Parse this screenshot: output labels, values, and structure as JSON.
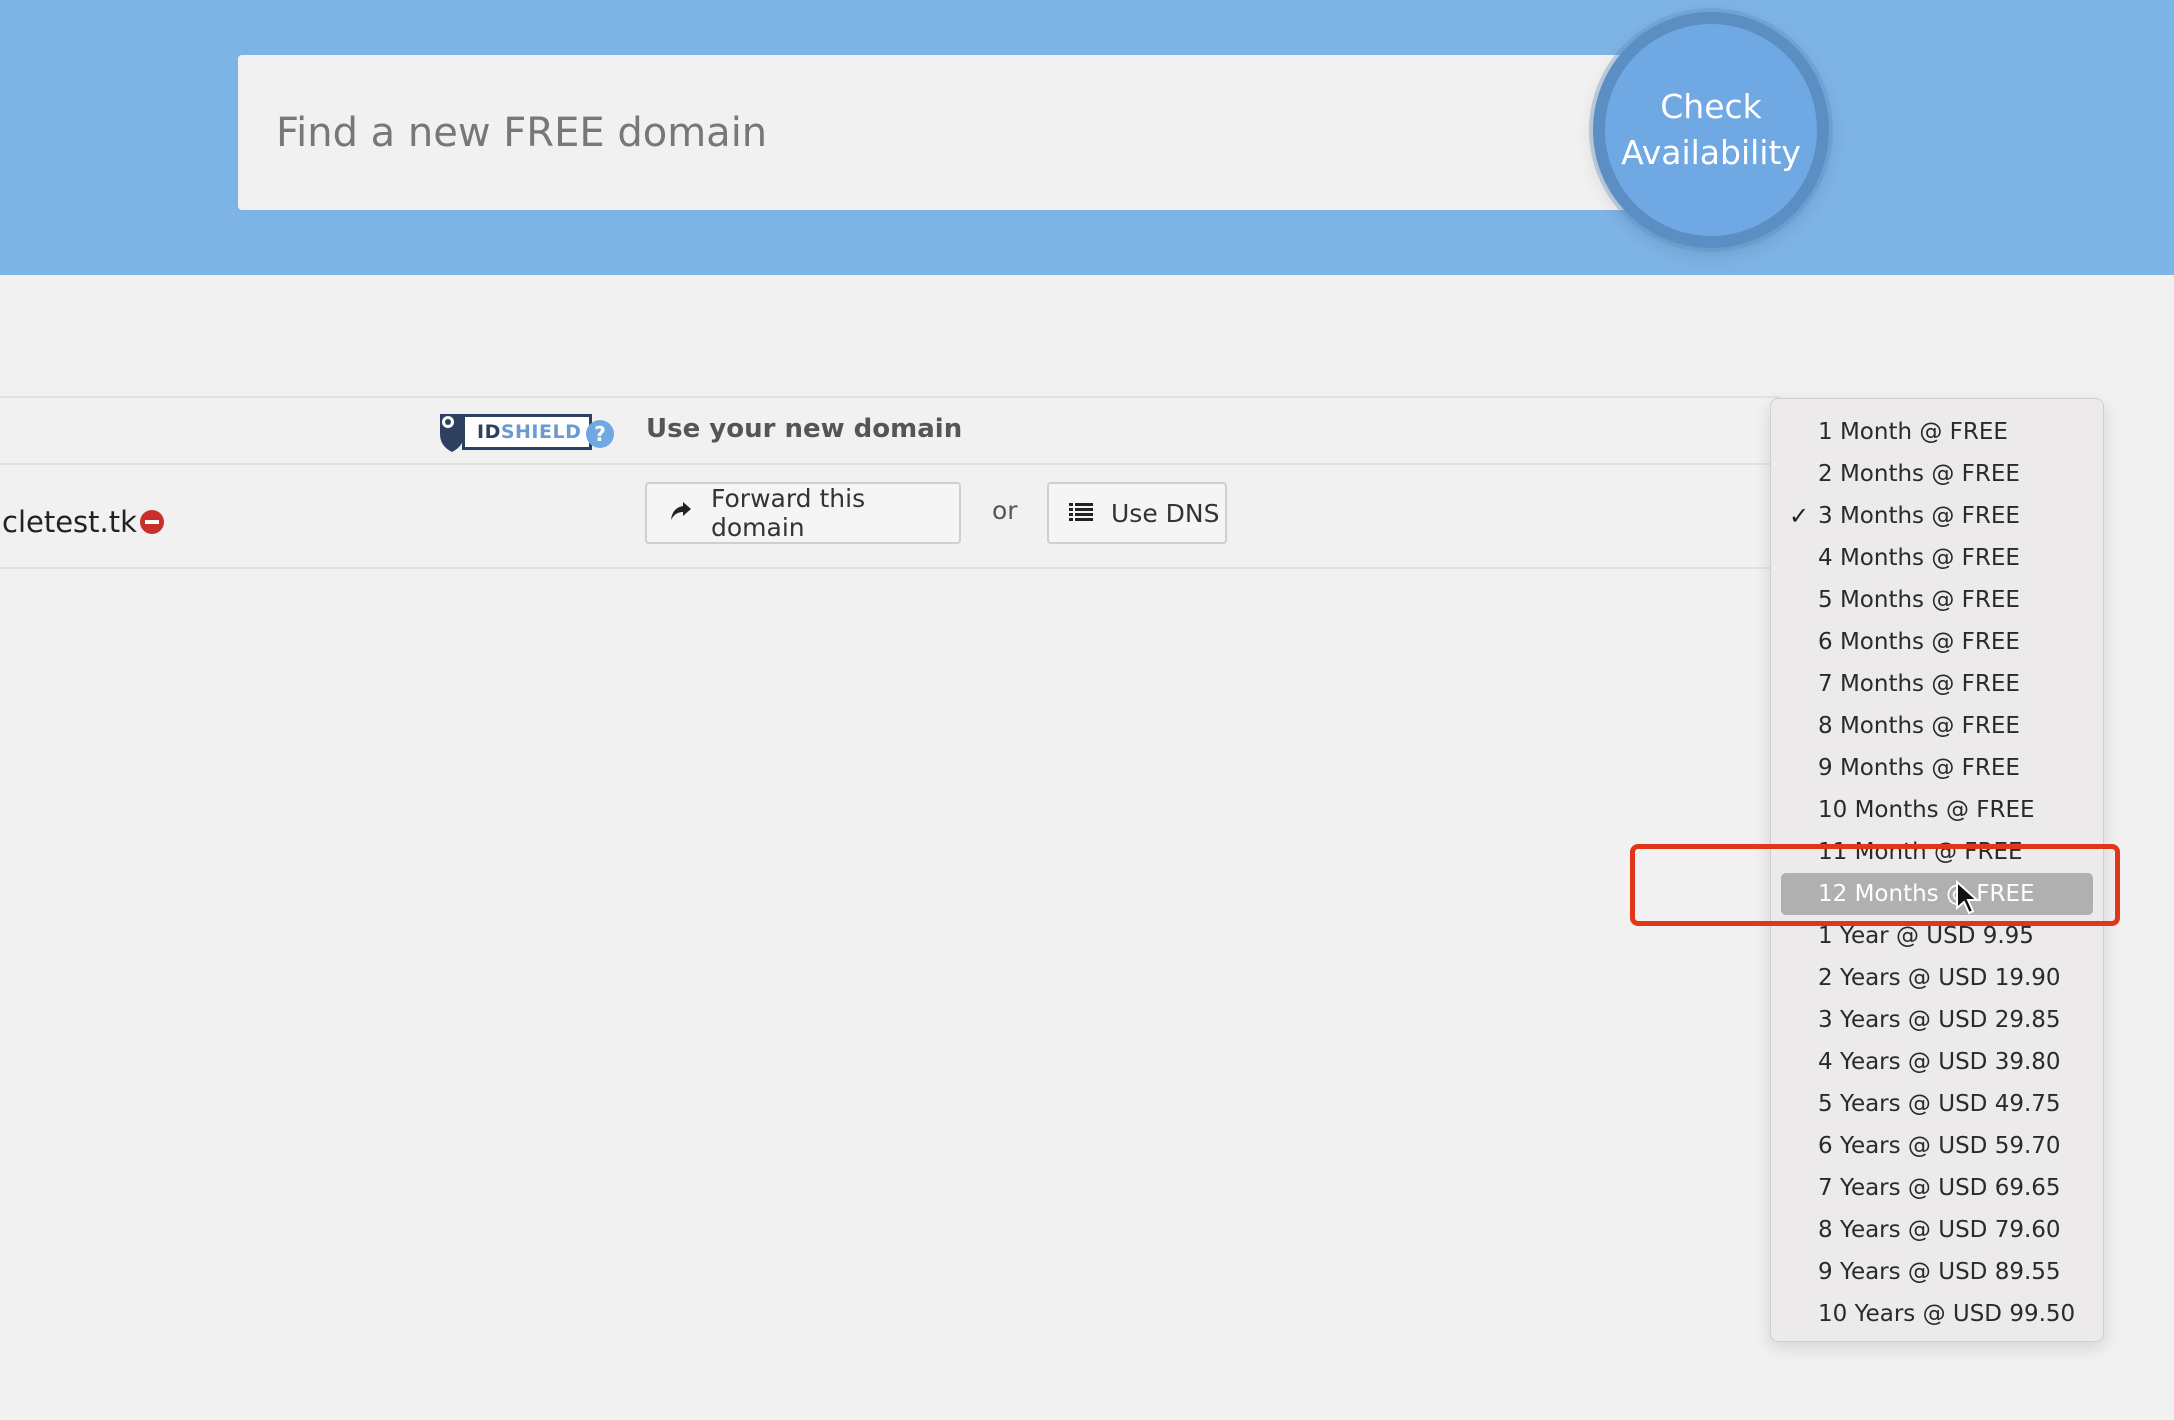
{
  "hero": {
    "search_placeholder": "Find a new FREE domain",
    "check_line1": "Check",
    "check_line2": "Availability"
  },
  "idshield": {
    "badge_part1": "ID",
    "badge_part2": "SHIELD",
    "help_glyph": "?",
    "use_domain_label": "Use your new domain"
  },
  "domain_row": {
    "domain_name": "cletest.tk",
    "forward_label": "Forward this domain",
    "or_label": "or",
    "dns_label": "Use DNS"
  },
  "dropdown": {
    "selected_value": "3 Months @ FREE",
    "hovered_value": "12 Months @ FREE",
    "options": [
      "1 Month @ FREE",
      "2 Months @ FREE",
      "3 Months @ FREE",
      "4 Months @ FREE",
      "5 Months @ FREE",
      "6 Months @ FREE",
      "7 Months @ FREE",
      "8 Months @ FREE",
      "9 Months @ FREE",
      "10 Months @ FREE",
      "11 Month @ FREE",
      "12 Months @ FREE",
      "1 Year @ USD 9.95",
      "2 Years @ USD 19.90",
      "3 Years @ USD 29.85",
      "4 Years @ USD 39.80",
      "5 Years @ USD 49.75",
      "6 Years @ USD 59.70",
      "7 Years @ USD 69.65",
      "8 Years @ USD 79.60",
      "9 Years @ USD 89.55",
      "10 Years @ USD 99.50"
    ]
  },
  "colors": {
    "hero_bg": "#7db3e5",
    "check_button": "#6fa8e2",
    "highlight_annotation": "#e2361b",
    "remove_icon": "#c9302c"
  },
  "icons": [
    "shield-icon",
    "help-icon",
    "remove-icon",
    "share-arrow-icon",
    "list-icon",
    "checkmark-icon",
    "mouse-cursor-icon"
  ]
}
